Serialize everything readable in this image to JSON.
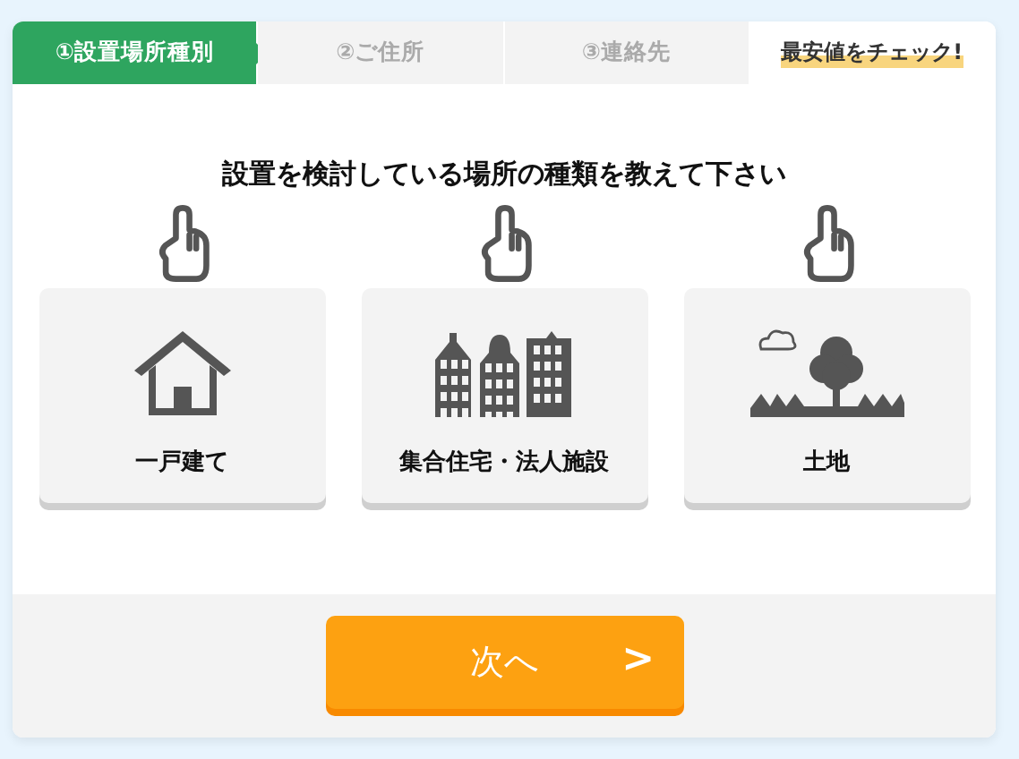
{
  "steps": [
    {
      "kind": "step",
      "label": "①設置場所種別",
      "selected": true
    },
    {
      "kind": "step",
      "label": "②ご住所",
      "selected": false
    },
    {
      "kind": "step",
      "label": "③連絡先",
      "selected": false
    },
    {
      "kind": "cta",
      "label": "最安値をチェック!",
      "selected": false
    }
  ],
  "question": "設置を検討している場所の種類を教えて下さい",
  "options": [
    {
      "kind": "house",
      "label": "一戸建て"
    },
    {
      "kind": "apartments",
      "label": "集合住宅・法人施設"
    },
    {
      "kind": "land",
      "label": "土地"
    }
  ],
  "next_button": {
    "label": "次へ",
    "arrow": ">"
  }
}
